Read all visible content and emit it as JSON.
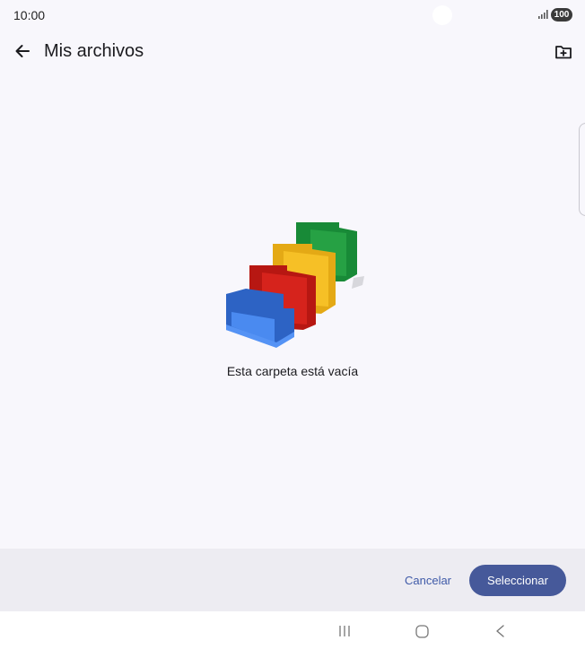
{
  "status_bar": {
    "time": "10:00",
    "battery": "100",
    "icons": [
      "signal-icon",
      "battery-icon"
    ]
  },
  "header": {
    "title": "Mis archivos",
    "back_icon": "arrow-back-icon",
    "new_folder_icon": "create-new-folder-icon"
  },
  "empty_state": {
    "message": "Esta carpeta está vacía",
    "illustration": "stacked-folders-illustration",
    "colors": [
      "#3b7be3",
      "#d6231c",
      "#f6c026",
      "#21963d"
    ]
  },
  "footer": {
    "cancel_label": "Cancelar",
    "select_label": "Seleccionar",
    "accent": "#46599a"
  },
  "nav": {
    "icons": [
      "recents-icon",
      "home-icon",
      "back-icon"
    ]
  }
}
